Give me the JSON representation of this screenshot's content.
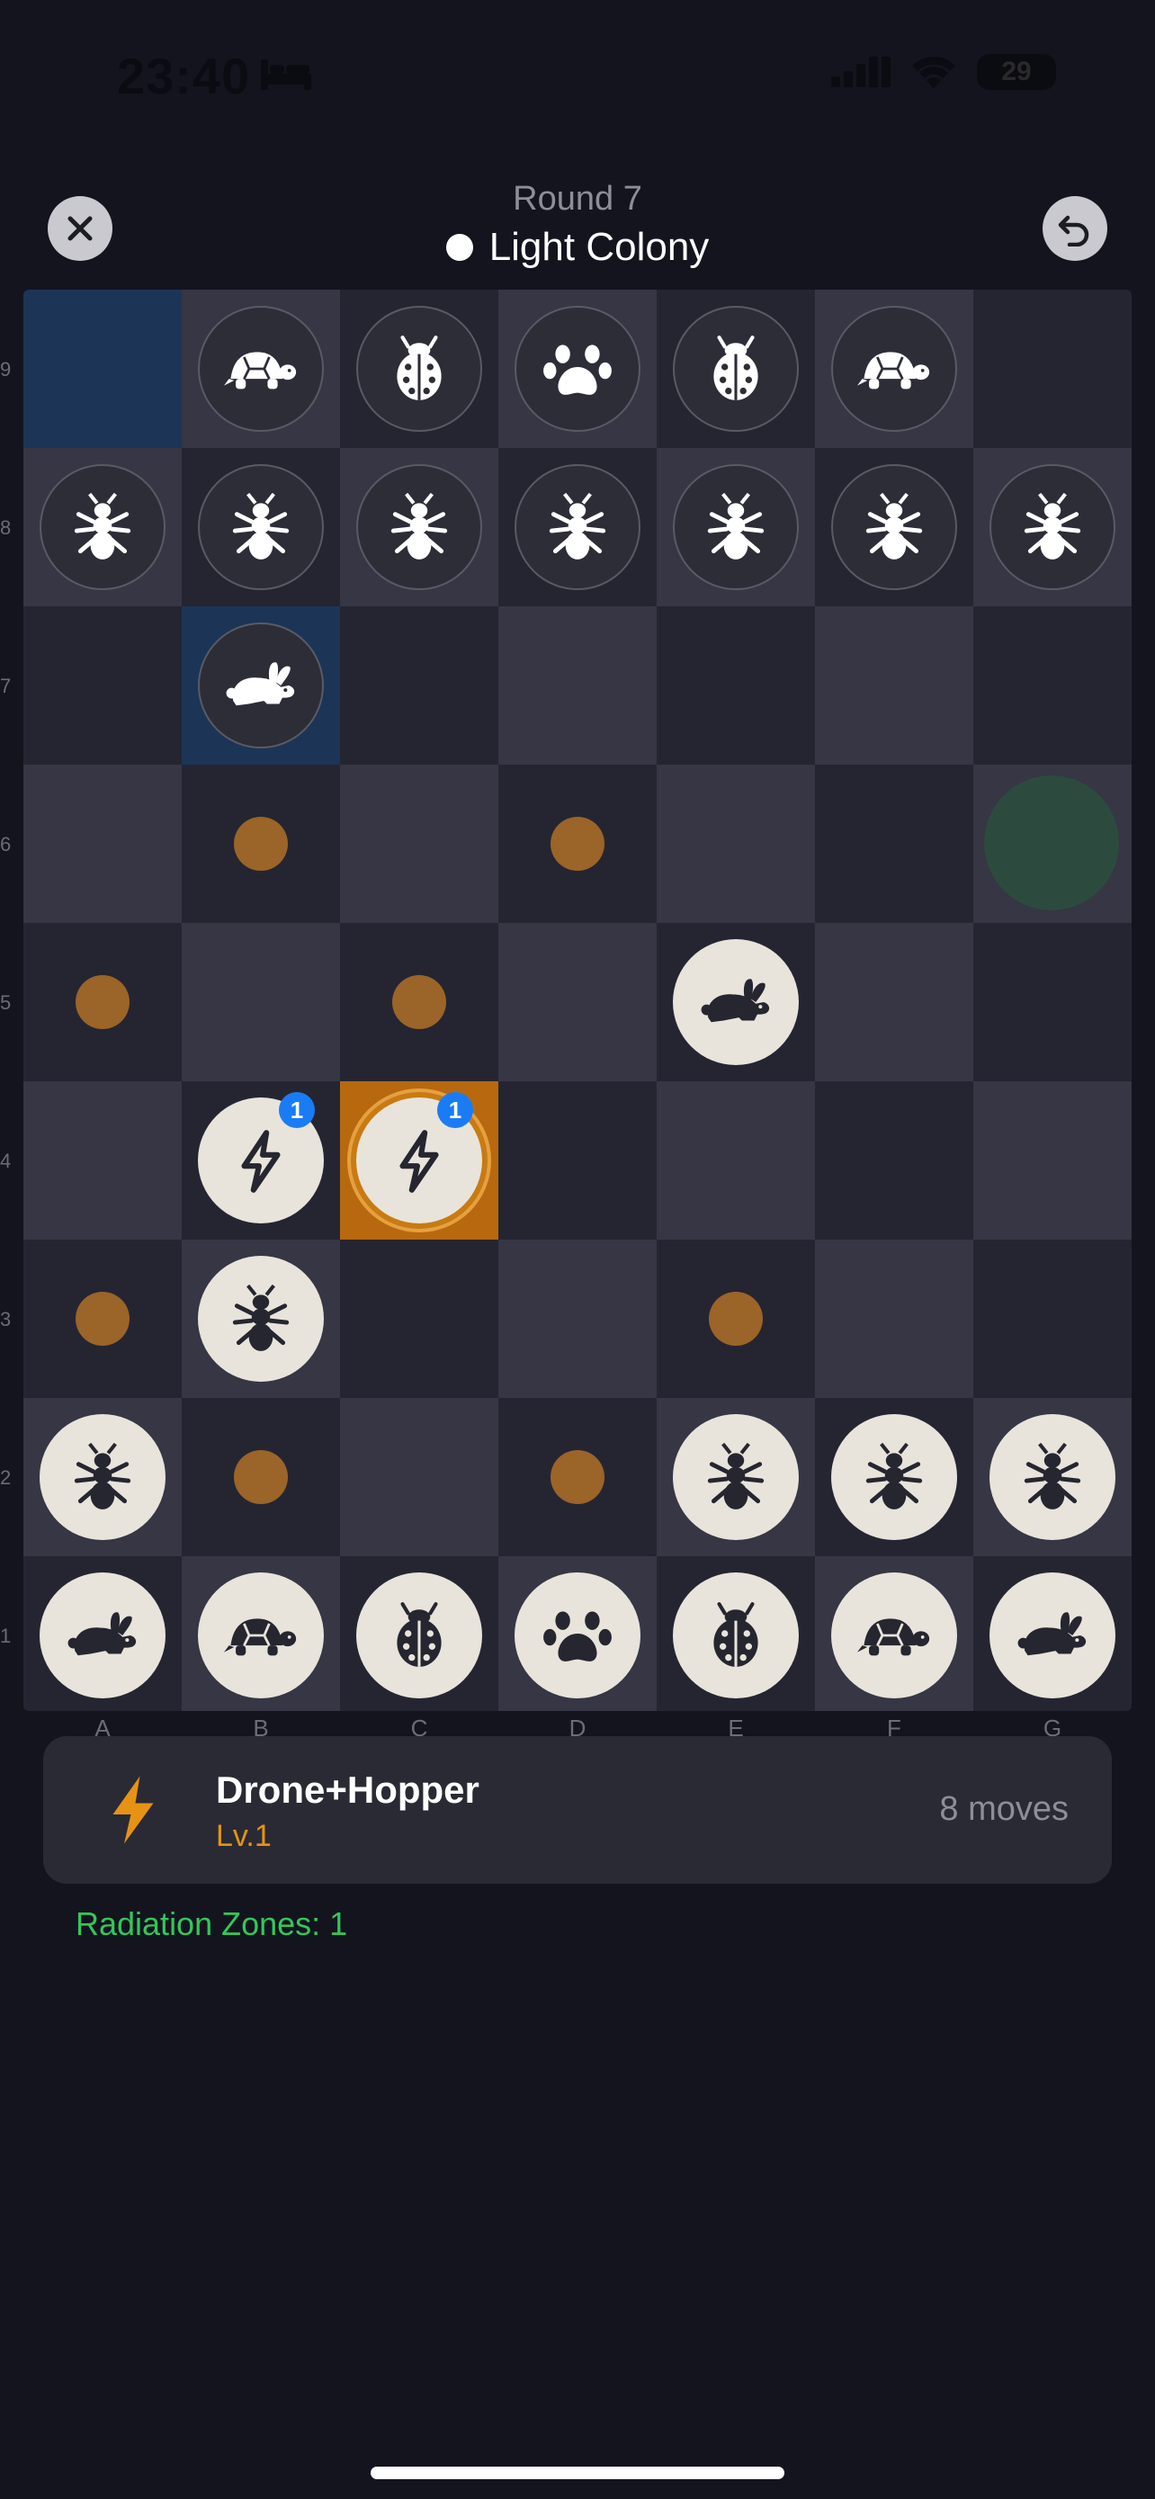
{
  "status": {
    "time": "23:40",
    "battery": "29"
  },
  "header": {
    "round": "Round 7",
    "colony": "Light Colony"
  },
  "board": {
    "columns": [
      "A",
      "B",
      "C",
      "D",
      "E",
      "F",
      "G"
    ],
    "rows": [
      "9",
      "8",
      "7",
      "6",
      "5",
      "4",
      "3",
      "2",
      "1"
    ],
    "pieces": [
      {
        "col": 1,
        "row": 0,
        "type": "turtle",
        "side": "dark"
      },
      {
        "col": 2,
        "row": 0,
        "type": "ladybug",
        "side": "dark"
      },
      {
        "col": 3,
        "row": 0,
        "type": "paw",
        "side": "dark"
      },
      {
        "col": 4,
        "row": 0,
        "type": "ladybug",
        "side": "dark"
      },
      {
        "col": 5,
        "row": 0,
        "type": "turtle",
        "side": "dark"
      },
      {
        "col": 0,
        "row": 1,
        "type": "ant",
        "side": "dark"
      },
      {
        "col": 1,
        "row": 1,
        "type": "ant",
        "side": "dark"
      },
      {
        "col": 2,
        "row": 1,
        "type": "ant",
        "side": "dark"
      },
      {
        "col": 3,
        "row": 1,
        "type": "ant",
        "side": "dark"
      },
      {
        "col": 4,
        "row": 1,
        "type": "ant",
        "side": "dark"
      },
      {
        "col": 5,
        "row": 1,
        "type": "ant",
        "side": "dark"
      },
      {
        "col": 6,
        "row": 1,
        "type": "ant",
        "side": "dark"
      },
      {
        "col": 1,
        "row": 2,
        "type": "rabbit",
        "side": "dark"
      },
      {
        "col": 4,
        "row": 4,
        "type": "rabbit",
        "side": "light"
      },
      {
        "col": 1,
        "row": 5,
        "type": "bolt",
        "side": "light",
        "badge": "1"
      },
      {
        "col": 2,
        "row": 5,
        "type": "bolt",
        "side": "light",
        "badge": "1",
        "selected": true
      },
      {
        "col": 1,
        "row": 6,
        "type": "ant",
        "side": "light"
      },
      {
        "col": 0,
        "row": 7,
        "type": "ant",
        "side": "light"
      },
      {
        "col": 4,
        "row": 7,
        "type": "ant",
        "side": "light"
      },
      {
        "col": 5,
        "row": 7,
        "type": "ant",
        "side": "light"
      },
      {
        "col": 6,
        "row": 7,
        "type": "ant",
        "side": "light"
      },
      {
        "col": 0,
        "row": 8,
        "type": "rabbit",
        "side": "light"
      },
      {
        "col": 1,
        "row": 8,
        "type": "turtle",
        "side": "light"
      },
      {
        "col": 2,
        "row": 8,
        "type": "ladybug",
        "side": "light"
      },
      {
        "col": 3,
        "row": 8,
        "type": "paw",
        "side": "light"
      },
      {
        "col": 4,
        "row": 8,
        "type": "ladybug",
        "side": "light"
      },
      {
        "col": 5,
        "row": 8,
        "type": "turtle",
        "side": "light"
      },
      {
        "col": 6,
        "row": 8,
        "type": "rabbit",
        "side": "light"
      }
    ],
    "move_dots": [
      {
        "col": 1,
        "row": 3
      },
      {
        "col": 3,
        "row": 3
      },
      {
        "col": 0,
        "row": 4
      },
      {
        "col": 2,
        "row": 4
      },
      {
        "col": 0,
        "row": 6
      },
      {
        "col": 4,
        "row": 6
      },
      {
        "col": 1,
        "row": 7
      },
      {
        "col": 3,
        "row": 7
      }
    ],
    "radiation_zones": [
      {
        "col": 6,
        "row": 3
      }
    ],
    "highlight_blue": [
      {
        "col": 0,
        "row": 0
      },
      {
        "col": 1,
        "row": 2
      }
    ],
    "highlight_selected": [
      {
        "col": 2,
        "row": 5
      }
    ]
  },
  "unit": {
    "name": "Drone+Hopper",
    "level": "Lv.1",
    "moves": "8 moves",
    "icon": "bolt-icon",
    "accent": "#e69315"
  },
  "radiation_text": "Radiation Zones: 1",
  "colors": {
    "dark_cell": "#252532",
    "light_cell": "#363644",
    "move_dot": "#9b6428",
    "badge": "#1a7cf5",
    "zone": "#2d4a3e"
  }
}
